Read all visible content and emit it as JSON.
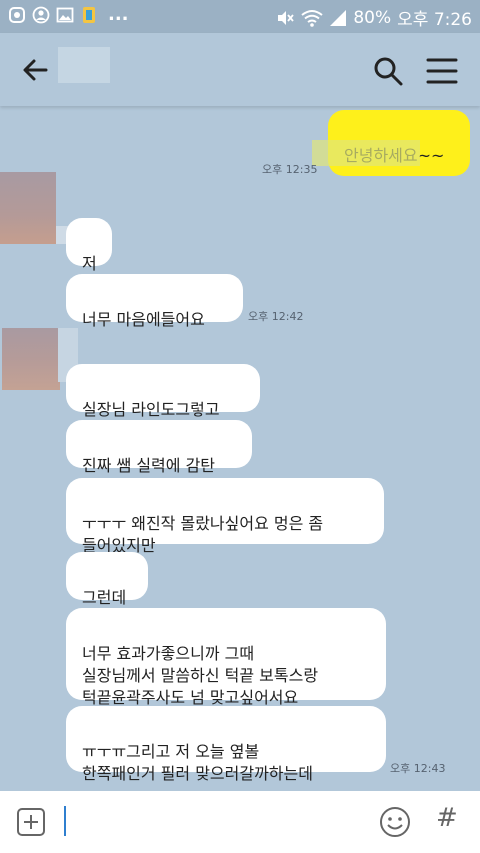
{
  "status_bar": {
    "dots": "...",
    "battery": "80%",
    "time": "오후 7:26"
  },
  "header": {
    "back_icon": "arrow-left-icon",
    "search_icon": "search-icon",
    "menu_icon": "hamburger-menu-icon"
  },
  "messages": [
    {
      "sender": "me",
      "text": "안녕하세요~~",
      "time": "오후 12:35"
    },
    {
      "sender": "other",
      "text": "저"
    },
    {
      "sender": "other",
      "text": "너무 마음에들어요",
      "time": "오후 12:42"
    },
    {
      "sender": "other",
      "text": "실장님 라인도그렇고"
    },
    {
      "sender": "other",
      "text": "진짜 쌤 실력에 감탄"
    },
    {
      "sender": "other",
      "text": "ㅜㅜㅜ 왜진작 몰랐나싶어요 멍은 좀\n들어있지만"
    },
    {
      "sender": "other",
      "text": "그런데"
    },
    {
      "sender": "other",
      "text": "너무 효과가좋으니까 그때\n실장님께서 말씀하신 턱끝 보톡스랑\n턱끝윤곽주사도 넘 맞고싶어서요"
    },
    {
      "sender": "other",
      "text": "ㅠㅜㅠ그리고 저 오늘 옆볼\n한쪽패인거 필러 맞으러갈까하는데",
      "time": "오후 12:43"
    }
  ],
  "input_bar": {
    "plus_icon": "plus-square-icon",
    "emoji_icon": "emoji-icon",
    "hash_label": "#"
  },
  "colors": {
    "background": "#b2c7d9",
    "my_bubble": "#fef01b",
    "other_bubble": "#ffffff"
  }
}
